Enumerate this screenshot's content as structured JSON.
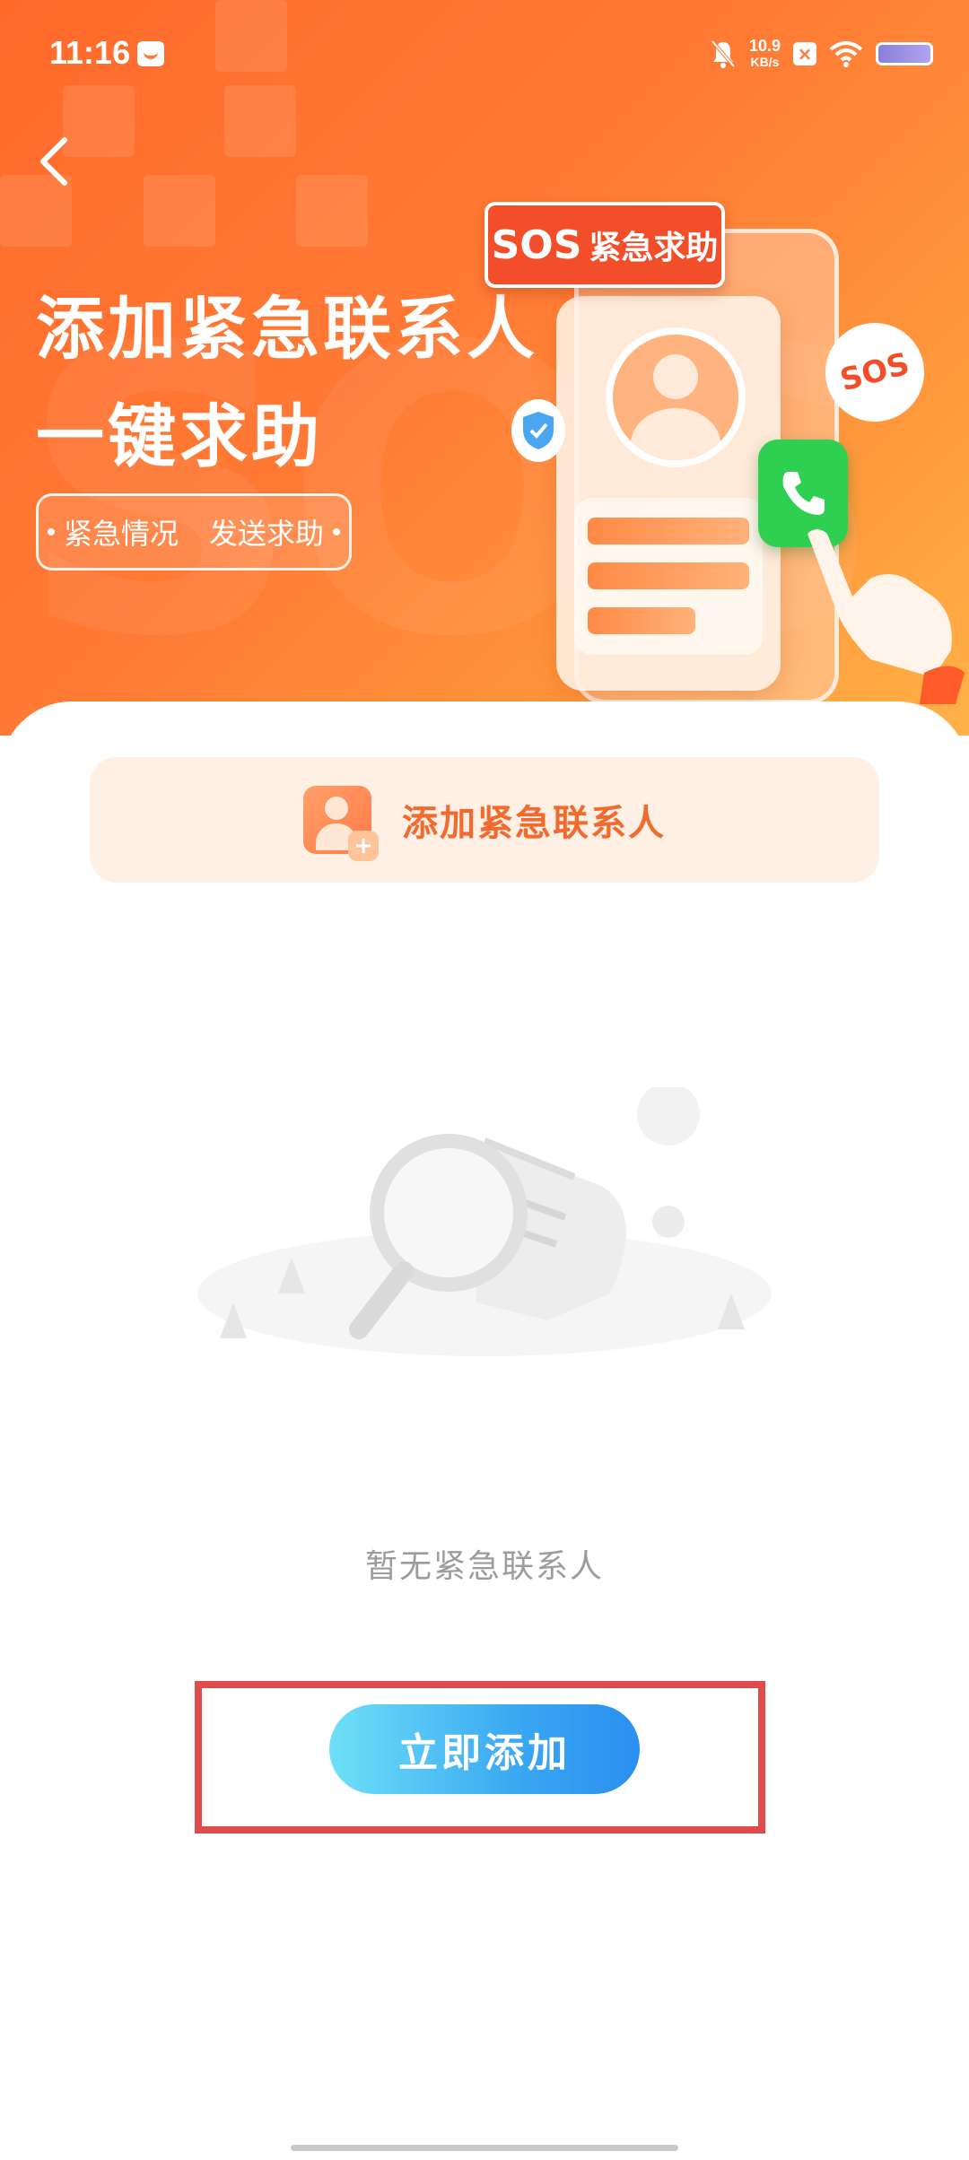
{
  "status_bar": {
    "time": "11:16",
    "speed_value": "10.9",
    "speed_unit": "KB/s"
  },
  "hero": {
    "title_line1": "添加紧急联系人",
    "title_line2": "一键求助",
    "tagline_left": "紧急情况",
    "tagline_right": "发送求助",
    "sos_tag_en": "SOS",
    "sos_tag_cn": "紧急求助",
    "sos_badge": "SOS"
  },
  "add_contact_bar": {
    "label": "添加紧急联系人"
  },
  "empty_state": {
    "message": "暂无紧急联系人"
  },
  "primary_button": {
    "label": "立即添加"
  },
  "colors": {
    "hero_orange": "#ff7a35",
    "accent_text": "#f26a2e",
    "button_blue": "#2b8ff1",
    "highlight_red": "#e24b4b"
  }
}
